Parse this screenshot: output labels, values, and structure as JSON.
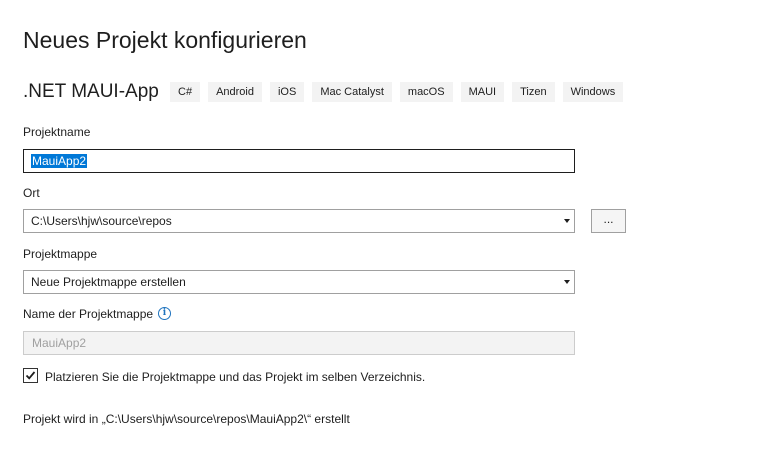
{
  "header": {
    "title": "Neues Projekt konfigurieren",
    "template_name": ".NET MAUI-App",
    "tags": [
      "C#",
      "Android",
      "iOS",
      "Mac Catalyst",
      "macOS",
      "MAUI",
      "Tizen",
      "Windows"
    ]
  },
  "form": {
    "project_name": {
      "label": "Projektname",
      "value": "MauiApp2"
    },
    "location": {
      "label": "Ort",
      "value": "C:\\Users\\hjw\\source\\repos",
      "browse_label": "..."
    },
    "solution": {
      "label": "Projektmappe",
      "value": "Neue Projektmappe erstellen"
    },
    "solution_name": {
      "label": "Name der Projektmappe",
      "value": "MauiApp2",
      "info_icon_glyph": "i"
    },
    "same_directory": {
      "label": "Platzieren Sie die Projektmappe und das Projekt im selben Verzeichnis.",
      "checked": true
    }
  },
  "footer": {
    "path_note": "Projekt wird in „C:\\Users\\hjw\\source\\repos\\MauiApp2\\“ erstellt"
  },
  "colors": {
    "selection": "#0078d7",
    "info": "#1e73be",
    "tag_background": "#f3f3f3"
  }
}
